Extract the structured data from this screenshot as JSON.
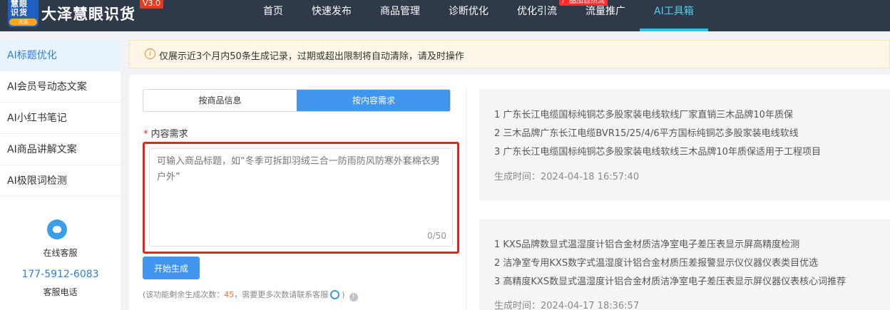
{
  "header": {
    "logo_line1": "慧眼",
    "logo_line2": "识货",
    "logo_tag": "大泽",
    "brand": "大泽慧眼识货",
    "version": "V3.0",
    "nav": [
      "首页",
      "快速发布",
      "商品管理",
      "诊断优化",
      "优化引流",
      "流量推广",
      "AI工具箱"
    ],
    "active_nav": "AI工具箱",
    "badge": "产品加自然流"
  },
  "sidebar": {
    "items": [
      "AI标题优化",
      "AI会员号动态文案",
      "AI小红书笔记",
      "AI商品讲解文案",
      "AI极限词检测"
    ],
    "active_item": "AI标题优化",
    "service_label": "在线客服",
    "phone": "177-5912-6083",
    "phone_label": "客服电话"
  },
  "notice": {
    "text": "仅展示近3个月内50条生成记录，过期或超出限制将自动清除，请及时操作"
  },
  "form": {
    "tabs": [
      "按商品信息",
      "按内容需求"
    ],
    "active_tab": "按内容需求",
    "field_label": "内容需求",
    "placeholder": "可输入商品标题，如“冬季可拆卸羽绒三合一防雨防风防寒外套棉衣男户外”",
    "value": "",
    "counter": "0/50",
    "submit_label": "开始生成",
    "remain_prefix": "(该功能剩余生成次数：",
    "remain_count": "45",
    "remain_suffix": "，需要更多次数请联系客服",
    "remain_close": ")"
  },
  "results": [
    {
      "lines": [
        "1 广东长江电缆国标纯铜芯多股家装电线软线厂家直销三木品牌10年质保",
        "2 三木品牌广东长江电缆BVR15/25/4/6平方国标纯铜芯多股家装电线软线",
        "3 广东长江电缆国标纯铜芯多股家装电线软线三木品牌10年质保适用于工程项目"
      ],
      "time_label": "生成时间：",
      "time": "2024-04-18 16:57:40"
    },
    {
      "lines": [
        "1 KXS品牌数显式温湿度计铝合金材质洁净室电子差压表显示屏高精度检测",
        "2 洁净室专用KXS数字式温湿度计铝合金材质压差报警显示仪仪器仪表类目优选",
        "3 高精度KXS数显式温湿度计铝合金材质洁净室电子差压表显示屏仪器仪表核心词推荐"
      ],
      "time_label": "生成时间：",
      "time": "2024-04-17 18:36:57"
    }
  ],
  "colors": {
    "nav_bg": "#2e3a4a",
    "accent": "#4096ee",
    "active_nav": "#4fd0e8",
    "highlight_border": "#e4241d",
    "remain_count": "#f56c2d"
  },
  "icons": [
    "info-icon",
    "customer-service-icon",
    "smile-icon",
    "help-icon"
  ]
}
